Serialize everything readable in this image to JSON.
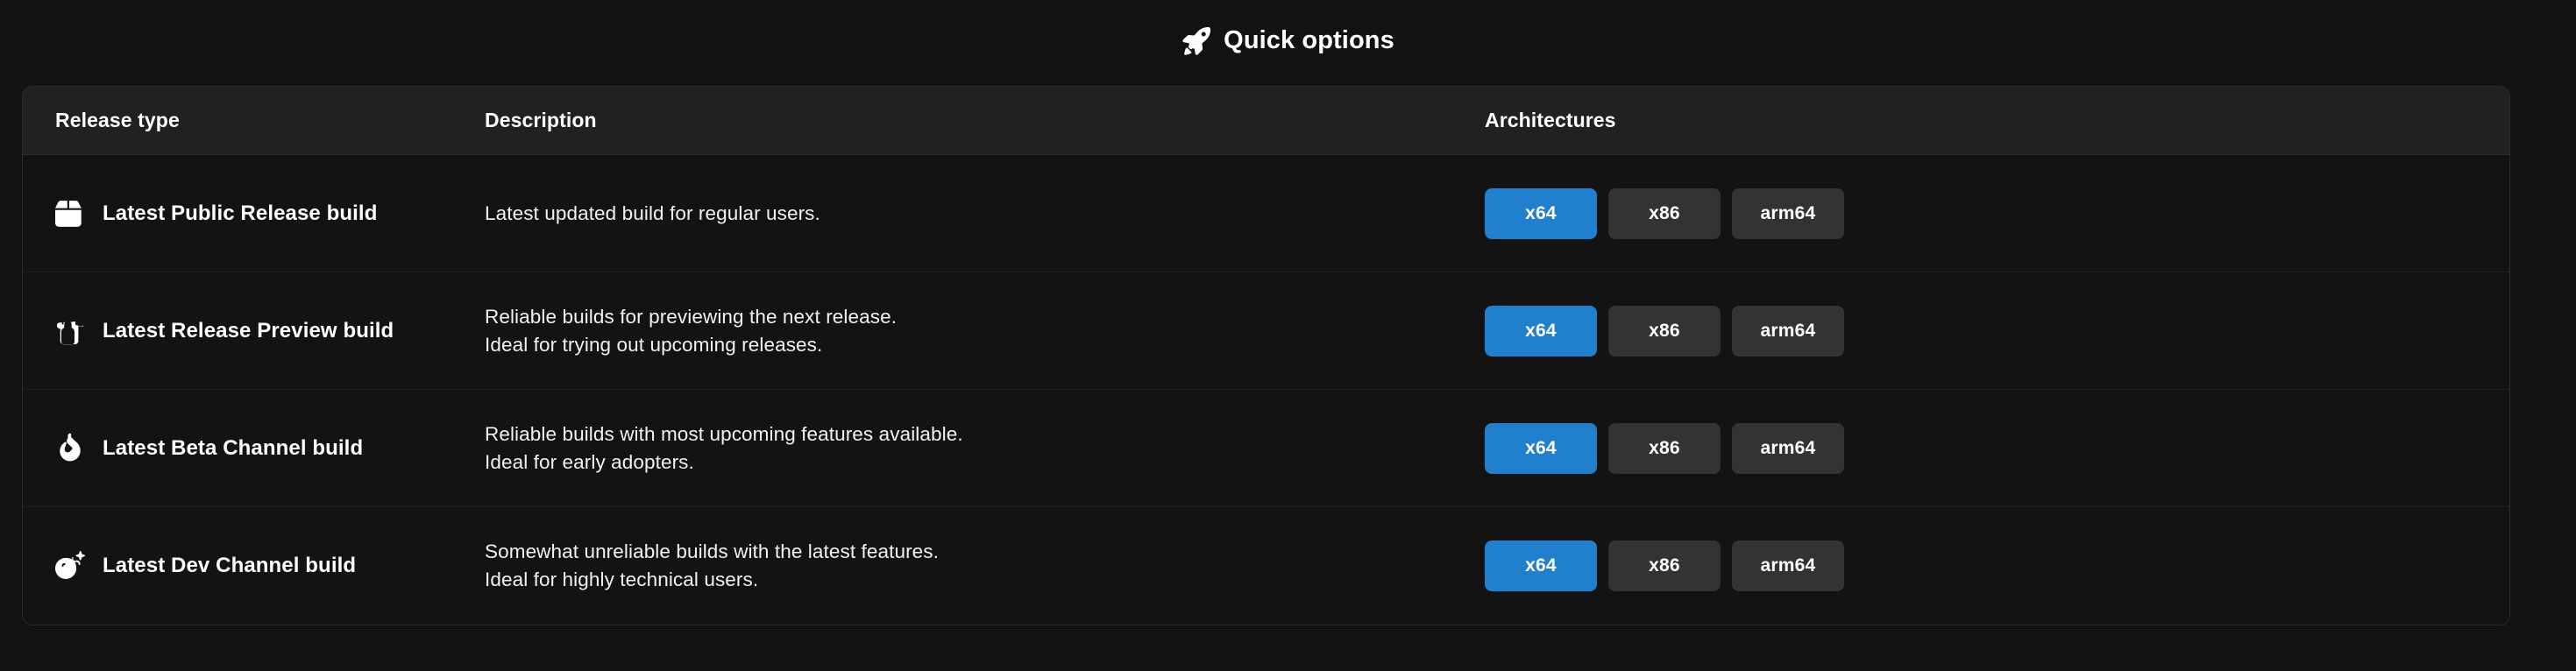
{
  "header": {
    "title": "Quick options",
    "icon": "rocket-icon"
  },
  "table": {
    "columns": {
      "release_type": "Release type",
      "description": "Description",
      "architectures": "Architectures"
    },
    "rows": [
      {
        "icon": "box-icon",
        "name": "Latest Public Release build",
        "description_lines": [
          "Latest updated build for regular users."
        ],
        "architectures": [
          {
            "label": "x64",
            "primary": true
          },
          {
            "label": "x86",
            "primary": false
          },
          {
            "label": "arm64",
            "primary": false
          }
        ]
      },
      {
        "icon": "fire-extinguisher-icon",
        "name": "Latest Release Preview build",
        "description_lines": [
          "Reliable builds for previewing the next release.",
          "Ideal for trying out upcoming releases."
        ],
        "architectures": [
          {
            "label": "x64",
            "primary": true
          },
          {
            "label": "x86",
            "primary": false
          },
          {
            "label": "arm64",
            "primary": false
          }
        ]
      },
      {
        "icon": "flame-icon",
        "name": "Latest Beta Channel build",
        "description_lines": [
          "Reliable builds with most upcoming features available.",
          "Ideal for early adopters."
        ],
        "architectures": [
          {
            "label": "x64",
            "primary": true
          },
          {
            "label": "x86",
            "primary": false
          },
          {
            "label": "arm64",
            "primary": false
          }
        ]
      },
      {
        "icon": "bomb-icon",
        "name": "Latest Dev Channel build",
        "description_lines": [
          "Somewhat unreliable builds with the latest features.",
          "Ideal for highly technical users."
        ],
        "architectures": [
          {
            "label": "x64",
            "primary": true
          },
          {
            "label": "x86",
            "primary": false
          },
          {
            "label": "arm64",
            "primary": false
          }
        ]
      }
    ]
  },
  "colors": {
    "page_background": "#121212",
    "card_background": "#131313",
    "header_background": "#212121",
    "accent": "#2180ce",
    "button_background": "#333333",
    "text": "#ffffff"
  }
}
